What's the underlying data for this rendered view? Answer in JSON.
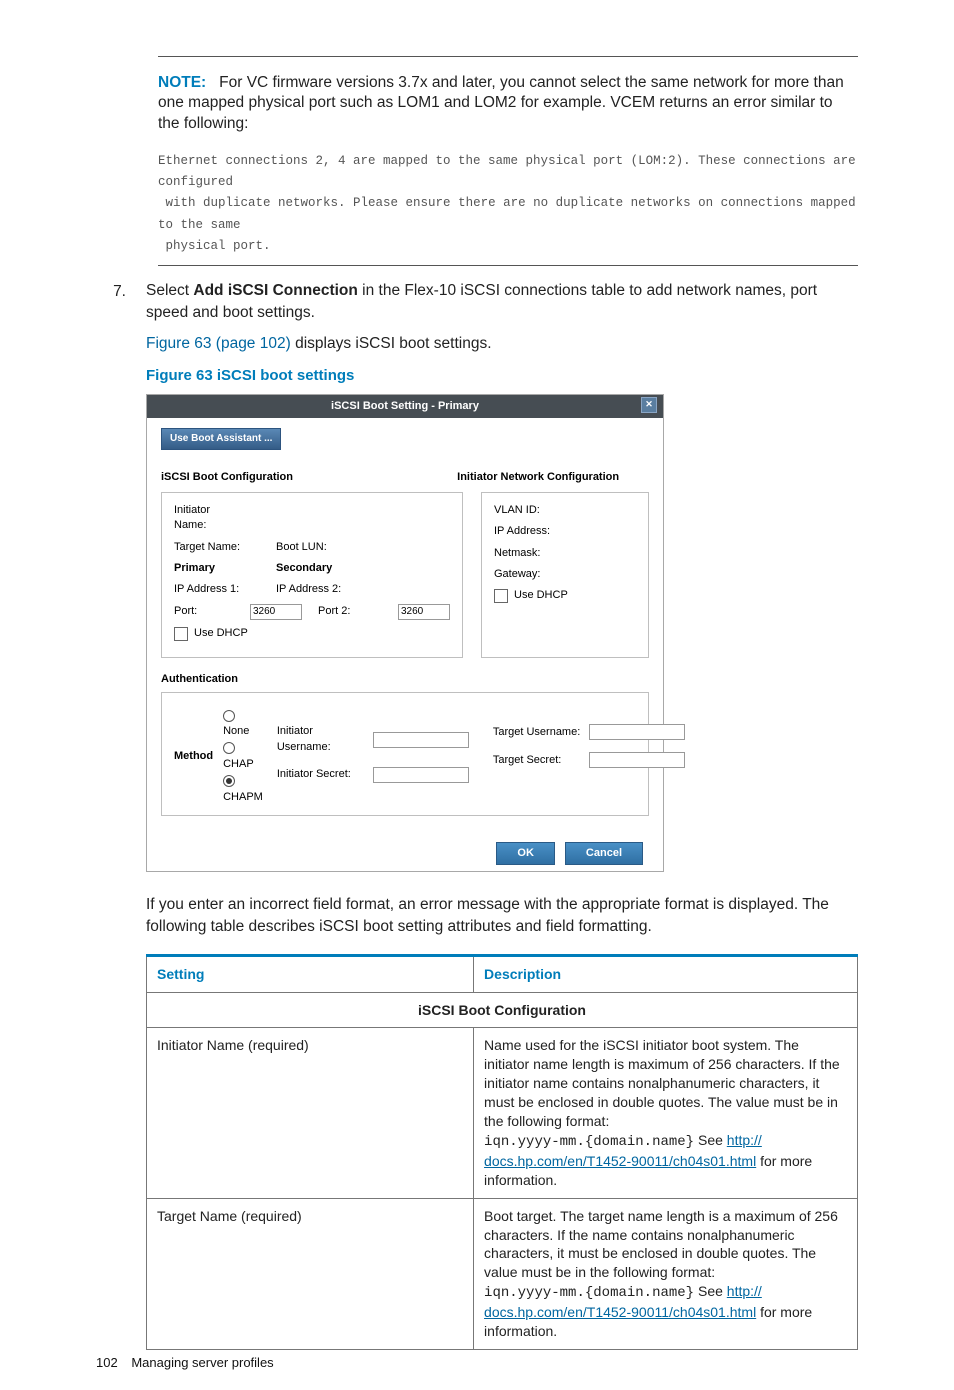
{
  "note": {
    "label": "NOTE:",
    "body": "For VC firmware versions 3.7x and later, you cannot select the same network for more than one mapped physical port such as LOM1 and LOM2 for example. VCEM returns an error similar to the following:",
    "code": "Ethernet connections 2, 4 are mapped to the same physical port (LOM:2). These connections are configured\n with duplicate networks. Please ensure there are no duplicate networks on connections mapped to the same\n physical port."
  },
  "step": {
    "number": "7.",
    "pre": "Select ",
    "bold": "Add iSCSI Connection",
    "post": " in the Flex-10 iSCSI connections table to add network names, port speed and boot settings.",
    "ref_link": "Figure 63 (page 102)",
    "ref_tail": " displays iSCSI boot settings.",
    "figure_caption": "Figure 63 iSCSI boot settings"
  },
  "dialog": {
    "title": "iSCSI Boot Setting - Primary",
    "close_glyph": "✕",
    "boot_assistant_btn": "Use Boot Assistant ...",
    "left_title": "iSCSI Boot Configuration",
    "right_title": "Initiator Network Configuration",
    "left": {
      "initiator_name": "Initiator Name:",
      "target_name": "Target Name:",
      "primary": "Primary",
      "secondary": "Secondary",
      "boot_lun": "Boot LUN:",
      "ip1": "IP Address 1:",
      "ip2": "IP Address 2:",
      "port": "Port:",
      "port2": "Port 2:",
      "port_val": "3260",
      "port2_val": "3260",
      "use_dhcp": "Use DHCP"
    },
    "right": {
      "vlan": "VLAN ID:",
      "ip": "IP Address:",
      "netmask": "Netmask:",
      "gateway": "Gateway:",
      "use_dhcp": "Use DHCP"
    },
    "auth_title": "Authentication",
    "method_label": "Method",
    "methods": [
      "None",
      "CHAP",
      "CHAPM"
    ],
    "selected_method_index": 2,
    "init_user": "Initiator Username:",
    "init_secret": "Initiator Secret:",
    "tgt_user": "Target Username:",
    "tgt_secret": "Target Secret:",
    "ok": "OK",
    "cancel": "Cancel"
  },
  "after_dialog": "If you enter an incorrect field format, an error message with the appropriate format is displayed. The following table describes iSCSI boot setting attributes and field formatting.",
  "table": {
    "head_setting": "Setting",
    "head_desc": "Description",
    "span_header": "iSCSI Boot Configuration",
    "rows": [
      {
        "setting": "Initiator Name (required)",
        "desc_pre": "Name used for the iSCSI initiator boot system. The initiator name length is maximum of 256 characters. If the initiator name contains nonalphanumeric characters, it must be enclosed in double quotes. The value must be in the following format:",
        "code": "iqn.yyyy-mm.{domain.name}",
        "see": " See ",
        "link1": "http://",
        "link2": "docs.hp.com/en/T1452-90011/ch04s01.html",
        "tail": " for more information."
      },
      {
        "setting": "Target Name (required)",
        "desc_pre": "Boot target. The target name length is a maximum of 256 characters. If the name contains nonalphanumeric characters, it must be enclosed in double quotes. The value must be in the following format:",
        "code": "iqn.yyyy-mm.{domain.name}",
        "see": " See ",
        "link1": "http://",
        "link2": "docs.hp.com/en/T1452-90011/ch04s01.html",
        "tail": " for more information."
      }
    ]
  },
  "footer": {
    "page": "102",
    "label": "Managing server profiles"
  }
}
